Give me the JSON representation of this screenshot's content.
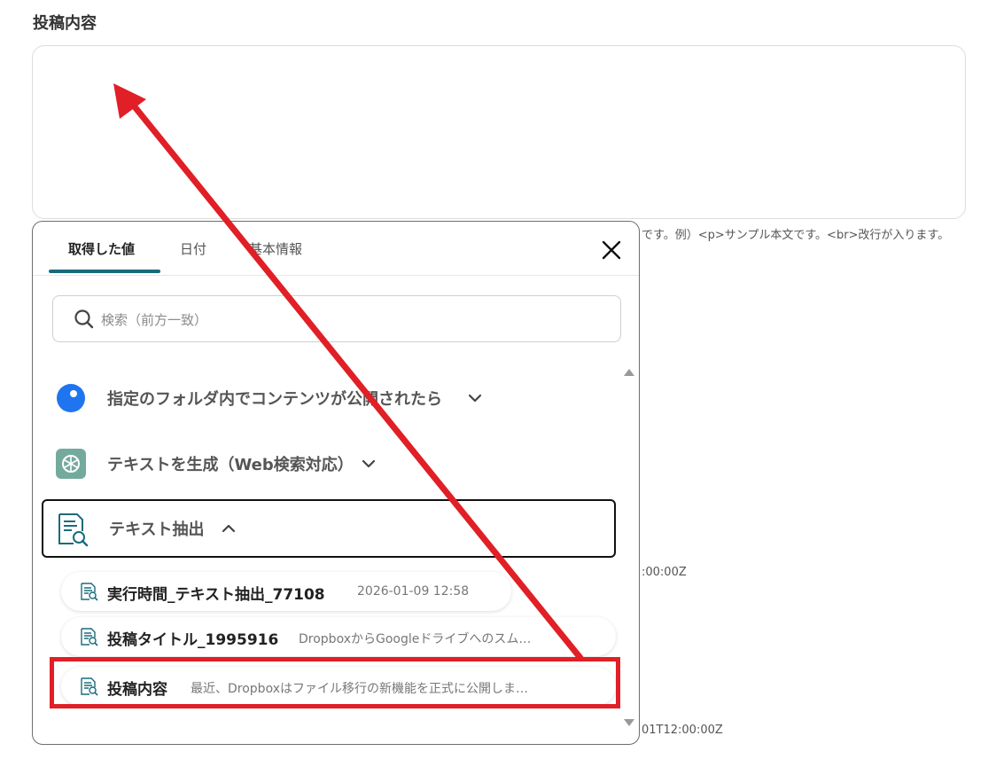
{
  "field": {
    "label": "投稿内容",
    "help_text": "です。例）<p>サンプル本文です。<br>改行が入ります。"
  },
  "background_fragments": [
    ":00:00Z",
    "01T12:00:00Z"
  ],
  "popup": {
    "tabs": [
      {
        "label": "取得した値",
        "active": true
      },
      {
        "label": "日付",
        "active": false
      },
      {
        "label": "基本情報",
        "active": false
      }
    ],
    "search": {
      "placeholder": "検索（前方一致）",
      "value": ""
    },
    "groups": [
      {
        "label": "指定のフォルダ内でコンテンツが公開されたら",
        "icon": "blue-circle-icon",
        "expanded": false
      },
      {
        "label": "テキストを生成（Web検索対応）",
        "icon": "openai-icon",
        "expanded": false
      },
      {
        "label": "テキスト抽出",
        "icon": "document-search-icon",
        "expanded": true
      }
    ],
    "items": [
      {
        "name": "実行時間_テキスト抽出_77108",
        "value": "2026-01-09 12:58"
      },
      {
        "name": "投稿タイトル_1995916",
        "value": "DropboxからGoogleドライブへのスム…"
      },
      {
        "name": "投稿内容",
        "value": "最近、Dropboxはファイル移行の新機能を正式に公開しま…"
      }
    ]
  },
  "colors": {
    "accent": "#1a6b7c",
    "annotation_red": "#e01f26",
    "blue_circle": "#1f74f0",
    "openai_green": "#74aa9c"
  }
}
